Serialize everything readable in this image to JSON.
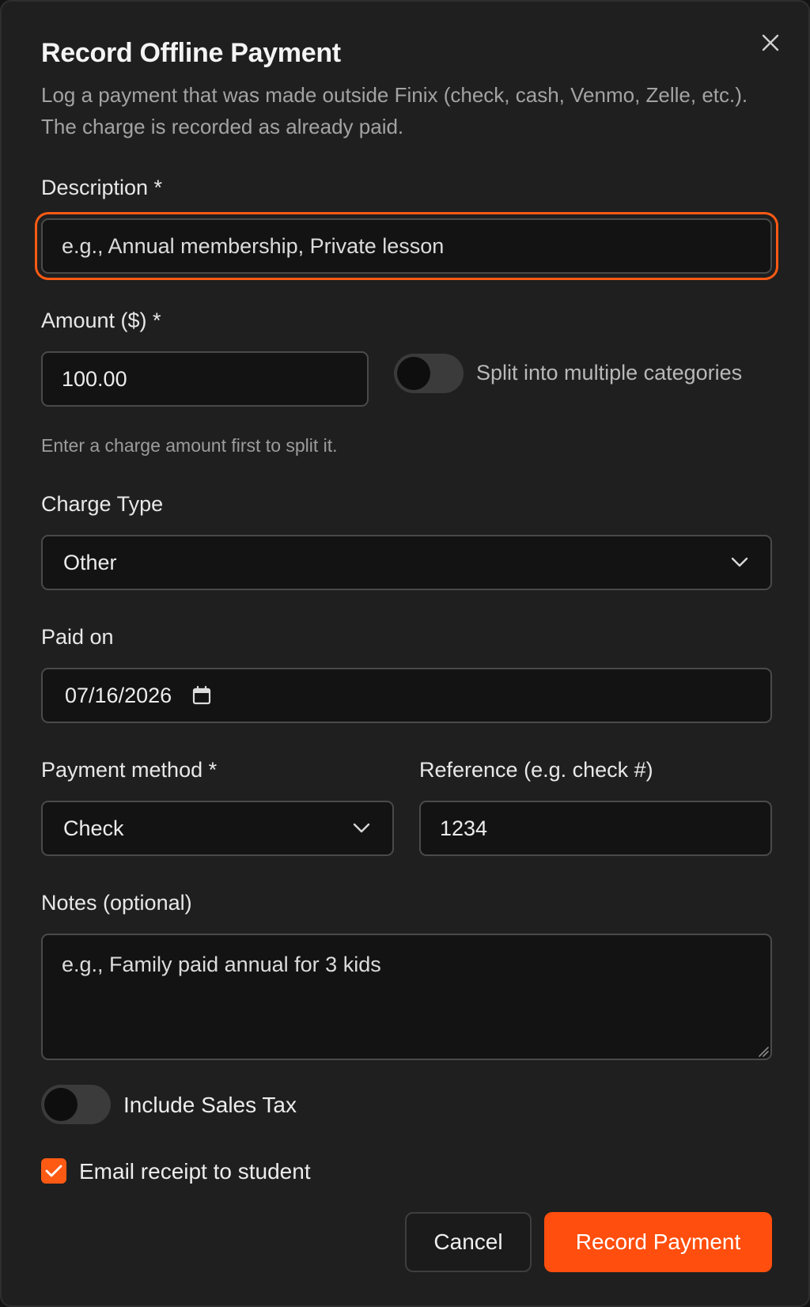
{
  "dialog": {
    "title": "Record Offline Payment",
    "subtitle": "Log a payment that was made outside Finix (check, cash, Venmo, Zelle, etc.). The charge is recorded as already paid."
  },
  "description": {
    "label": "Description *",
    "placeholder": "e.g., Annual membership, Private lesson",
    "value": ""
  },
  "amount": {
    "label": "Amount ($) *",
    "value": "100.00",
    "split_label": "Split into multiple categories",
    "split_enabled": false,
    "helper": "Enter a charge amount first to split it."
  },
  "charge_type": {
    "label": "Charge Type",
    "value": "Other"
  },
  "paid_on": {
    "label": "Paid on",
    "value": "07/16/2026"
  },
  "payment_method": {
    "label": "Payment method *",
    "value": "Check"
  },
  "reference": {
    "label": "Reference (e.g. check #)",
    "value": "1234"
  },
  "notes": {
    "label": "Notes (optional)",
    "placeholder": "e.g., Family paid annual for 3 kids"
  },
  "sales_tax": {
    "label": "Include Sales Tax",
    "enabled": false
  },
  "email_receipt": {
    "label": "Email receipt to student",
    "checked": true
  },
  "actions": {
    "cancel": "Cancel",
    "submit": "Record Payment"
  },
  "colors": {
    "accent": "#ff4e0d",
    "background": "#1f1f1f",
    "field_background": "#131313"
  }
}
